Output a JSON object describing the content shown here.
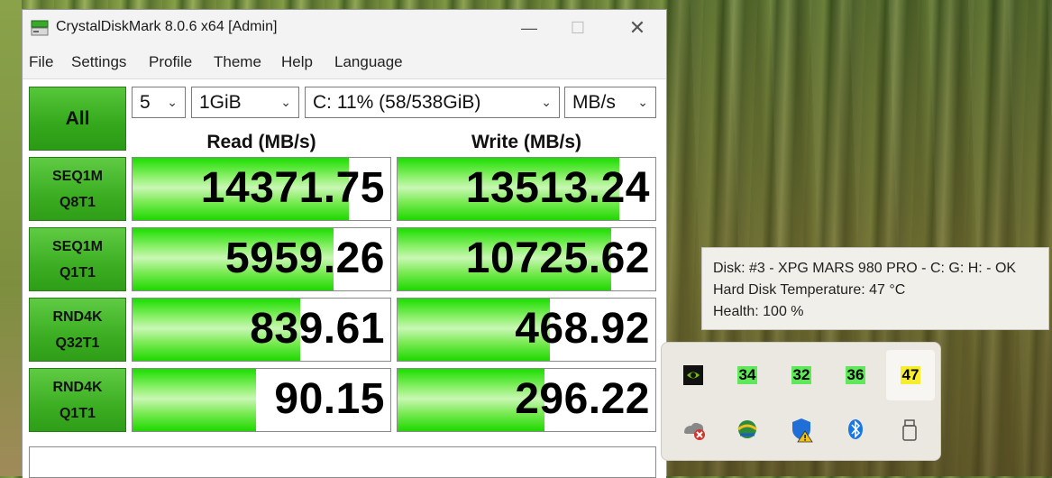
{
  "window": {
    "title": "CrystalDiskMark 8.0.6 x64 [Admin]",
    "controls": {
      "minimize": "—",
      "maximize": "☐",
      "close": "✕"
    }
  },
  "menu": [
    "File",
    "Settings",
    "Profile",
    "Theme",
    "Help",
    "Language"
  ],
  "toolbar": {
    "all_label": "All",
    "count": "5",
    "size": "1GiB",
    "drive": "C: 11% (58/538GiB)",
    "unit": "MB/s"
  },
  "headers": {
    "read": "Read (MB/s)",
    "write": "Write (MB/s)"
  },
  "tests": [
    {
      "line1": "SEQ1M",
      "line2": "Q8T1",
      "read": "14371.75",
      "write": "13513.24",
      "read_fill": 0.84,
      "write_fill": 0.86
    },
    {
      "line1": "SEQ1M",
      "line2": "Q1T1",
      "read": "5959.26",
      "write": "10725.62",
      "read_fill": 0.78,
      "write_fill": 0.83
    },
    {
      "line1": "RND4K",
      "line2": "Q32T1",
      "read": "839.61",
      "write": "468.92",
      "read_fill": 0.65,
      "write_fill": 0.59
    },
    {
      "line1": "RND4K",
      "line2": "Q1T1",
      "read": "90.15",
      "write": "296.22",
      "read_fill": 0.48,
      "write_fill": 0.57
    }
  ],
  "comment": "",
  "tooltip": {
    "line1": "Disk: #3 - XPG MARS 980 PRO - C: G: H: - OK",
    "line2": "Hard Disk Temperature: 47 °C",
    "line3": "Health: 100 %"
  },
  "tray": {
    "temps": [
      "34",
      "32",
      "36",
      "47"
    ],
    "icons": [
      "nvidia-icon",
      "onedrive-error-icon",
      "network-globe-icon",
      "security-warning-icon",
      "bluetooth-icon",
      "usb-drive-icon"
    ]
  }
}
